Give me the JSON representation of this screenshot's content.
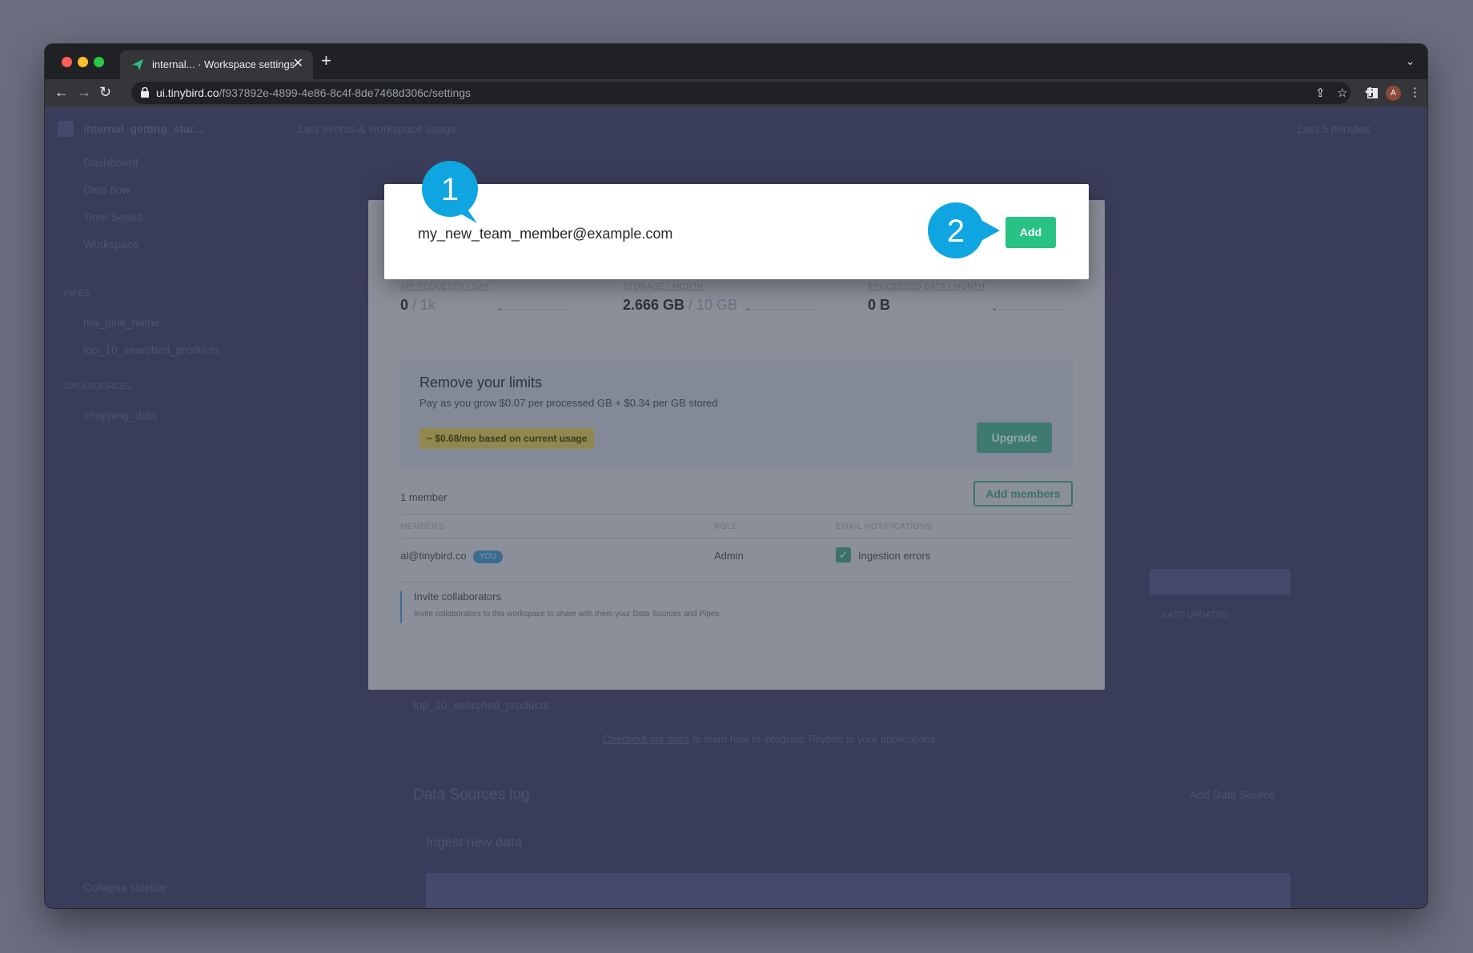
{
  "browser": {
    "tab_title": "internal... · Workspace settings",
    "tab_close": "✕",
    "new_tab": "+",
    "url_host": "ui.tinybird.co",
    "url_path": "/f937892e-4899-4e86-8c4f-8de7468d306c/settings",
    "avatar_initial": "A"
  },
  "background": {
    "workspace_name": "internal_getting_star...",
    "topbar_text": "Last events & workspace usage",
    "time_range": "Last 5 minutes",
    "nav_items": [
      "Dashboard",
      "Data flow",
      "Time Series",
      "Workspace"
    ],
    "pipes_header": "PIPES",
    "pipe_items": [
      "ma_pink_name",
      "top_10_searched_products"
    ],
    "sources_header": "DATA SOURCES",
    "source_items": [
      "shopping_data"
    ],
    "collapse_label": "Collapse sidebar",
    "pipe_link": "top_10_searched_products",
    "section_title": "Data Sources log",
    "add_source_label": "Add Data Source",
    "ingest_title": "Ingest new data",
    "last_updated_label": "LAST UPDATED"
  },
  "workspace": {
    "usage": [
      {
        "label": "API REQUESTS / DAY",
        "value": "0",
        "limit": " / 1k"
      },
      {
        "label": "STORAGE / MONTH",
        "value": "2.666 GB",
        "limit": " / 10 GB"
      },
      {
        "label": "PROCESSED DATA / MONTH",
        "value": "0 B",
        "limit": ""
      }
    ],
    "dash": "-",
    "limits_title": "Remove your limits",
    "limits_sub": "Pay as you grow $0.07 per processed GB + $0.34 per GB stored",
    "usage_estimate": "~ $0.68/mo based on current usage",
    "upgrade_label": "Upgrade",
    "member_count": "1 member",
    "add_members_label": "Add members",
    "columns": [
      "MEMBERS",
      "ROLE",
      "EMAIL NOTIFICATIONS"
    ],
    "member": {
      "email": "al@tinybird.co",
      "badge": "YOU",
      "role": "Admin",
      "notification": "Ingestion errors"
    },
    "invite_title": "Invite collaborators",
    "invite_sub": "Invite collaborators to this workspace to share with them your Data Sources and Pipes."
  },
  "invite": {
    "email_value": "my_new_team_member@example.com",
    "add_label": "Add"
  },
  "callouts": {
    "step1": "1",
    "step2": "2",
    "color": "#0ea5e0"
  },
  "footer": {
    "docs_link": "Checkout our docs",
    "docs_rest": " to learn how to integrate Tinybird in your applications"
  }
}
